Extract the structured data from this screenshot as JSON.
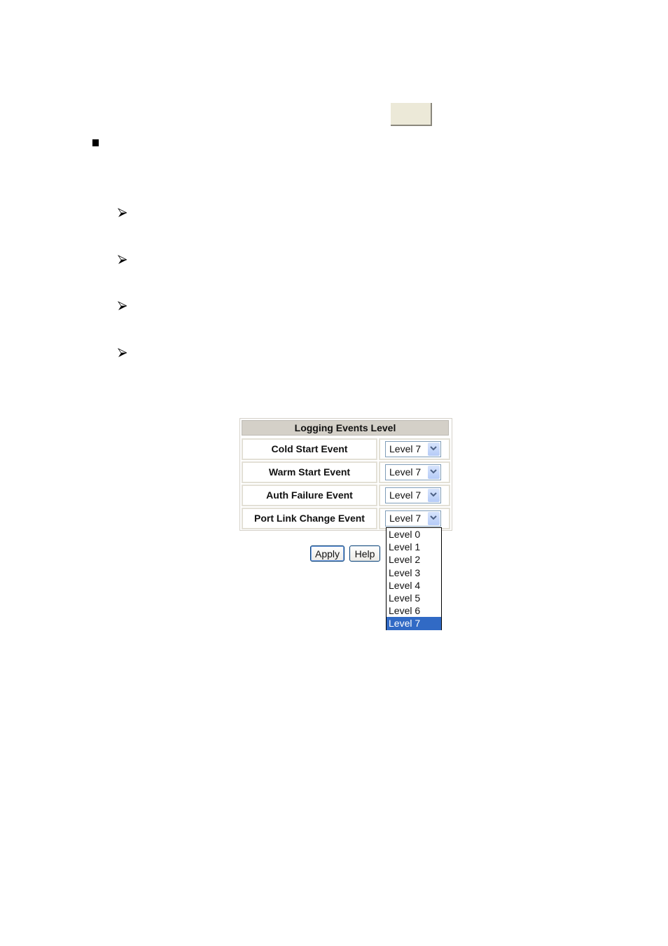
{
  "top_button": {
    "label": ""
  },
  "bullets": {
    "square": "square-bullet",
    "arrows": [
      "arrow-bullet",
      "arrow-bullet",
      "arrow-bullet",
      "arrow-bullet"
    ]
  },
  "logging_table": {
    "title": "Logging Events Level",
    "rows": [
      {
        "label": "Cold Start Event",
        "value": "Level 7"
      },
      {
        "label": "Warm Start Event",
        "value": "Level 7"
      },
      {
        "label": "Auth Failure Event",
        "value": "Level 7"
      },
      {
        "label": "Port Link Change Event",
        "value": "Level 7"
      }
    ]
  },
  "dropdown": {
    "options": [
      "Level 0",
      "Level 1",
      "Level 2",
      "Level 3",
      "Level 4",
      "Level 5",
      "Level 6",
      "Level 7"
    ],
    "selected": "Level 7"
  },
  "buttons": {
    "apply": "Apply",
    "help": "Help"
  },
  "colors": {
    "selection": "#316ac5",
    "header_bg": "#d4d0c8",
    "button_face": "#ece9d8"
  }
}
